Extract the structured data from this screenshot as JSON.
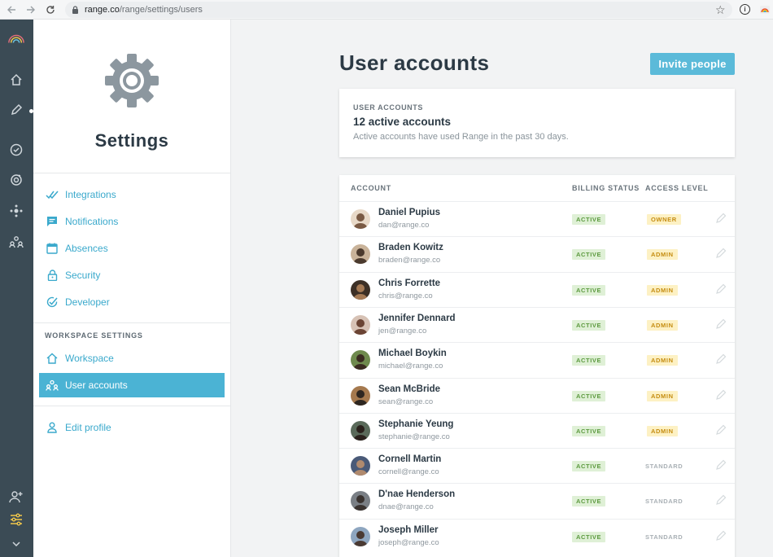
{
  "browser": {
    "url_domain": "range.co",
    "url_path": "/range/settings/users"
  },
  "settings": {
    "title": "Settings",
    "nav": [
      {
        "label": "Integrations",
        "icon": "check-double-icon"
      },
      {
        "label": "Notifications",
        "icon": "chat-icon"
      },
      {
        "label": "Absences",
        "icon": "calendar-icon"
      },
      {
        "label": "Security",
        "icon": "lock-icon"
      },
      {
        "label": "Developer",
        "icon": "check-circle-icon"
      }
    ],
    "workspace_section_label": "WORKSPACE SETTINGS",
    "workspace_nav": [
      {
        "label": "Workspace",
        "icon": "home-icon"
      },
      {
        "label": "User accounts",
        "icon": "users-icon",
        "active": true
      }
    ],
    "edit_profile_label": "Edit profile"
  },
  "main": {
    "title": "User accounts",
    "invite_label": "Invite people",
    "summary": {
      "label": "USER ACCOUNTS",
      "count": "12 active accounts",
      "desc": "Active accounts have used Range in the past 30 days."
    },
    "table": {
      "headers": {
        "account": "ACCOUNT",
        "billing": "BILLING STATUS",
        "access": "ACCESS LEVEL"
      },
      "rows": [
        {
          "name": "Daniel Pupius",
          "email": "dan@range.co",
          "billing": "ACTIVE",
          "access": "OWNER"
        },
        {
          "name": "Braden Kowitz",
          "email": "braden@range.co",
          "billing": "ACTIVE",
          "access": "ADMIN"
        },
        {
          "name": "Chris Forrette",
          "email": "chris@range.co",
          "billing": "ACTIVE",
          "access": "ADMIN"
        },
        {
          "name": "Jennifer Dennard",
          "email": "jen@range.co",
          "billing": "ACTIVE",
          "access": "ADMIN"
        },
        {
          "name": "Michael Boykin",
          "email": "michael@range.co",
          "billing": "ACTIVE",
          "access": "ADMIN"
        },
        {
          "name": "Sean McBride",
          "email": "sean@range.co",
          "billing": "ACTIVE",
          "access": "ADMIN"
        },
        {
          "name": "Stephanie Yeung",
          "email": "stephanie@range.co",
          "billing": "ACTIVE",
          "access": "ADMIN"
        },
        {
          "name": "Cornell Martin",
          "email": "cornell@range.co",
          "billing": "ACTIVE",
          "access": "STANDARD"
        },
        {
          "name": "D'nae Henderson",
          "email": "dnae@range.co",
          "billing": "ACTIVE",
          "access": "STANDARD"
        },
        {
          "name": "Joseph Miller",
          "email": "joseph@range.co",
          "billing": "ACTIVE",
          "access": "STANDARD"
        }
      ]
    }
  },
  "colors": {
    "rail": "#3b4b55",
    "accent": "#4bb3d4",
    "link": "#3aa9cc",
    "billing_active_bg": "#dff0d6",
    "admin_bg": "#fdf1c4"
  }
}
